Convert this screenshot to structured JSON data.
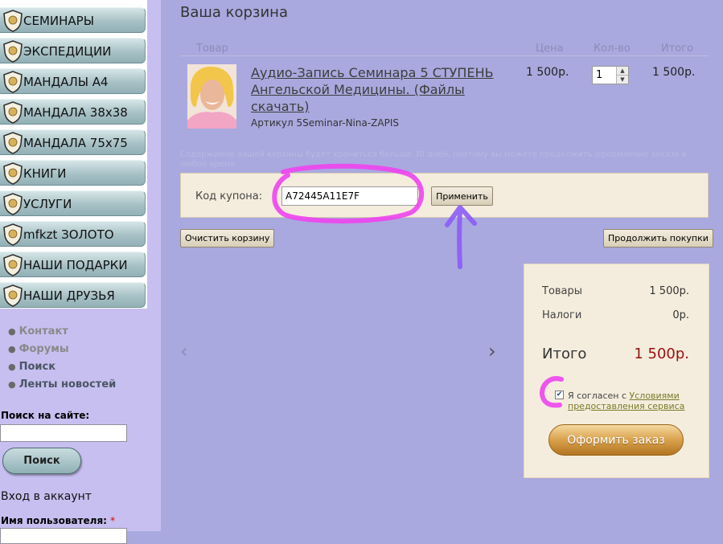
{
  "menu": {
    "items": [
      {
        "label": "СЕМИНАРЫ"
      },
      {
        "label": "ЭКСПЕДИЦИИ"
      },
      {
        "label": "МАНДАЛЫ А4"
      },
      {
        "label": "МАНДАЛА 38x38"
      },
      {
        "label": "МАНДАЛА 75x75"
      },
      {
        "label": "КНИГИ"
      },
      {
        "label": "УСЛУГИ"
      },
      {
        "label": "mfkzt ЗОЛОТО"
      },
      {
        "label": "НАШИ ПОДАРКИ"
      },
      {
        "label": "НАШИ ДРУЗЬЯ"
      }
    ]
  },
  "links": {
    "items": [
      {
        "label": "Контакт"
      },
      {
        "label": "Форумы"
      },
      {
        "label": "Поиск"
      },
      {
        "label": "Ленты новостей"
      }
    ]
  },
  "search": {
    "label": "Поиск на сайте:",
    "value": "",
    "button": "Поиск"
  },
  "login": {
    "title": "Вход в аккаунт",
    "username_label": "Имя пользователя:",
    "required_mark": "*"
  },
  "cart": {
    "title": "Ваша корзина",
    "columns": {
      "product": "Товар",
      "price": "Цена",
      "qty": "Кол-во",
      "total": "Итого"
    },
    "item": {
      "name": "Аудио-Запись Семинара 5 СТУПЕНЬ Ангельской Медицины. (Файлы скачать)",
      "sku": "Артикул 5Seminar-Nina-ZAPIS",
      "price": "1 500р.",
      "qty": "1",
      "total": "1 500р."
    },
    "storage_note": "Содержимое вашей корзины будет храниться больше 30 дней, поэтому вы можете продолжить оформление заказа в любое время.",
    "coupon": {
      "label": "Код купона:",
      "value": "A72445A11E7F",
      "apply": "Применить"
    },
    "clear": "Очистить корзину",
    "continue": "Продолжить покупки"
  },
  "summary": {
    "goods_label": "Товары",
    "goods_value": "1 500р.",
    "tax_label": "Налоги",
    "tax_value": "0р.",
    "total_label": "Итого",
    "total_value": "1 500р.",
    "agree_prefix": "Я согласен с",
    "agree_link": "Условиями предоставления сервиса",
    "agree_checked": true,
    "checkout": "Оформить заказ"
  },
  "icons": {
    "shield": "shield-icon",
    "arrow_left": "chevron-left-icon",
    "arrow_right": "chevron-right-icon",
    "bullet": "bullet-icon",
    "check": "checkmark-icon"
  },
  "colors": {
    "page_bg": "#a9a9df",
    "sidebar_bg": "#c7bff0",
    "panel_bg": "#f4eddd",
    "total_red": "#9b1010",
    "annotation_magenta": "#ee44ee",
    "annotation_violet": "#8b5cf6"
  }
}
